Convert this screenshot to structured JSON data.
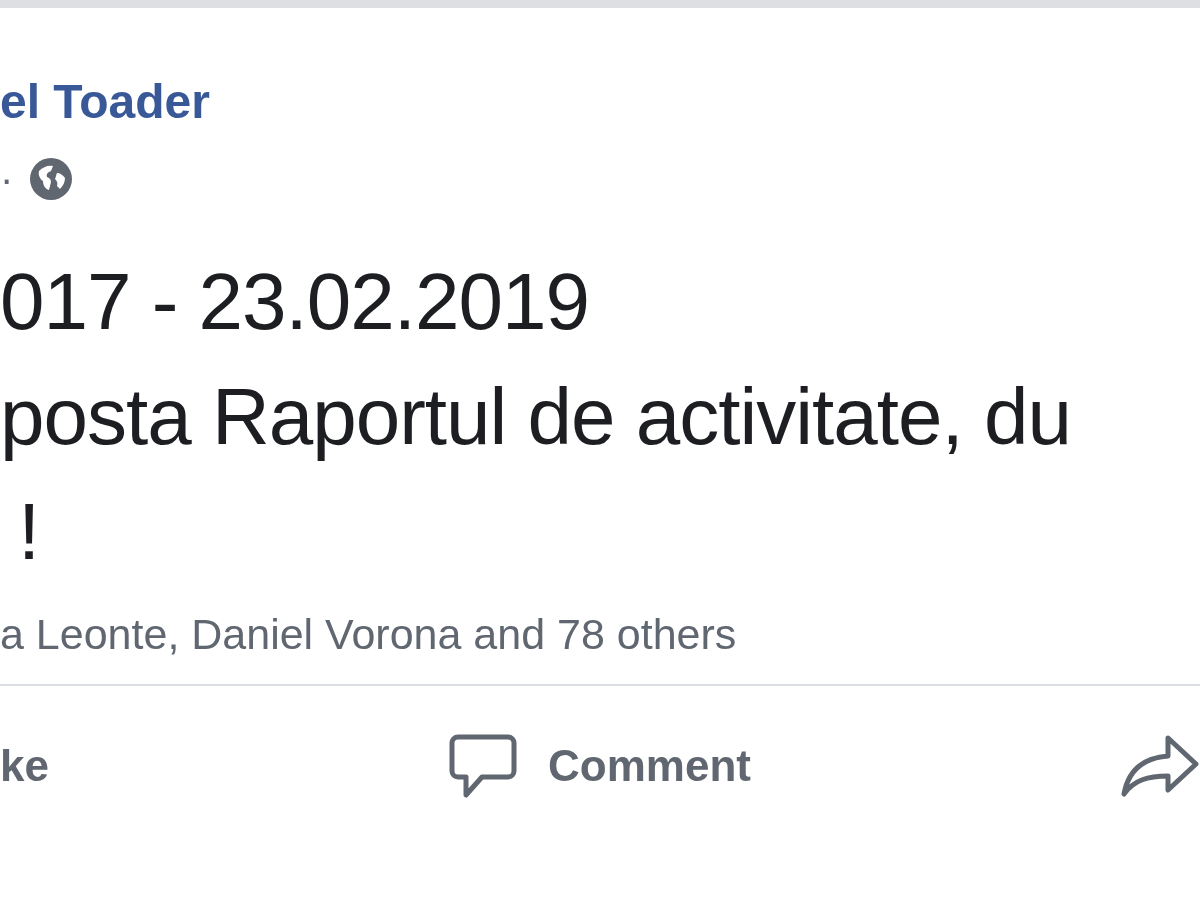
{
  "post": {
    "author": "el Toader",
    "meta_separator": "·",
    "lines": [
      "017 - 23.02.2019",
      "posta Raportul de activitate, du",
      "!"
    ]
  },
  "reactions": {
    "text": "a Leonte, Daniel Vorona and 78 others"
  },
  "actions": [
    {
      "kind": "like",
      "label": "ke"
    },
    {
      "kind": "comment",
      "label": "Comment"
    },
    {
      "kind": "share"
    }
  ]
}
